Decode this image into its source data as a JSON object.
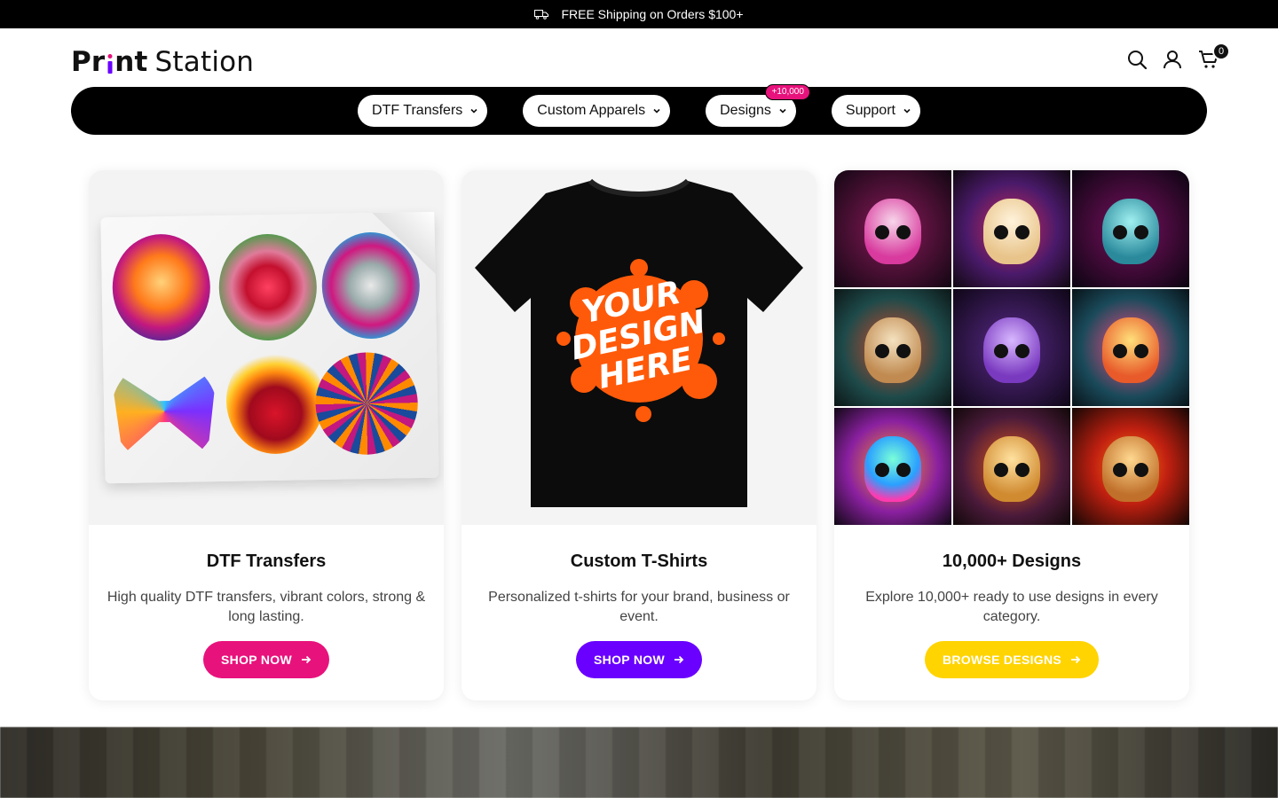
{
  "announcement": {
    "text": "FREE Shipping on Orders $100+",
    "icon": "truck-icon"
  },
  "brand": {
    "part1": "Pr",
    "dotted_letter": "i",
    "part2": "nt",
    "part3": "Station"
  },
  "header": {
    "cart_count": "0",
    "icons": [
      "search-icon",
      "account-icon",
      "cart-icon"
    ]
  },
  "nav": {
    "items": [
      {
        "label": "DTF Transfers"
      },
      {
        "label": "Custom Apparels"
      },
      {
        "label": "Designs",
        "badge": "+10,000"
      },
      {
        "label": "Support"
      }
    ]
  },
  "cards": [
    {
      "title": "DTF Transfers",
      "description": "High quality DTF transfers, vibrant colors, strong & long lasting.",
      "button": "SHOP NOW",
      "button_color": "#e8127c"
    },
    {
      "title": "Custom T-Shirts",
      "description": "Personalized t-shirts for your brand, business or event.",
      "button": "SHOP NOW",
      "button_color": "#6a00ff",
      "image_text": [
        "YOUR",
        "DESIGN",
        "HERE"
      ]
    },
    {
      "title": "10,000+ Designs",
      "description": "Explore 10,000+ ready to use designs in every category.",
      "button": "BROWSE DESIGNS",
      "button_color": "#ffd400"
    }
  ],
  "colors": {
    "accent_pink": "#e8127c",
    "accent_purple": "#6a00ff",
    "accent_yellow": "#ffd400",
    "bar": "#000000"
  }
}
